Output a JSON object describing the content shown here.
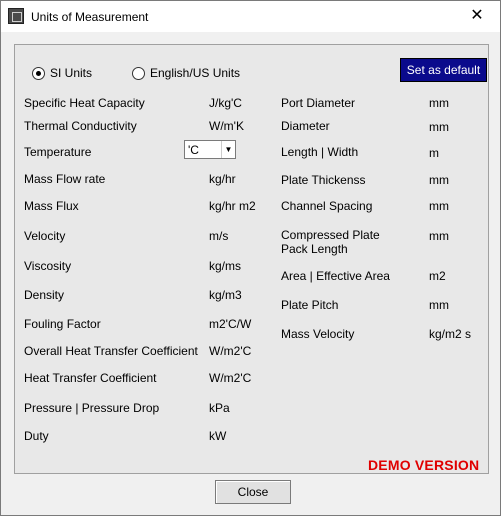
{
  "window": {
    "title": "Units of Measurement",
    "close_glyph": "✕"
  },
  "unit_system": {
    "si_label": "SI Units",
    "english_label": "English/US Units",
    "selected": "SI Units"
  },
  "set_default_label": "Set as default",
  "left_rows": [
    {
      "label": "Specific Heat Capacity",
      "unit": "J/kg'C"
    },
    {
      "label": "Thermal Conductivity",
      "unit": "W/m'K"
    },
    {
      "label": "Temperature",
      "unit": "'C"
    },
    {
      "label": "Mass Flow rate",
      "unit": "kg/hr"
    },
    {
      "label": "Mass Flux",
      "unit": "kg/hr m2"
    },
    {
      "label": "Velocity",
      "unit": "m/s"
    },
    {
      "label": "Viscosity",
      "unit": "kg/ms"
    },
    {
      "label": "Density",
      "unit": "kg/m3"
    },
    {
      "label": "Fouling Factor",
      "unit": "m2'C/W"
    },
    {
      "label": "Overall Heat Transfer Coefficient",
      "unit": "W/m2'C"
    },
    {
      "label": "Heat Transfer Coefficient",
      "unit": "W/m2'C"
    },
    {
      "label": "Pressure | Pressure Drop",
      "unit": "kPa"
    },
    {
      "label": "Duty",
      "unit": "kW"
    }
  ],
  "right_rows": [
    {
      "label": "Port Diameter",
      "unit": "mm"
    },
    {
      "label": "Diameter",
      "unit": "mm"
    },
    {
      "label": "Length | Width",
      "unit": "m"
    },
    {
      "label": "Plate Thickenss",
      "unit": "mm"
    },
    {
      "label": "Channel Spacing",
      "unit": "mm"
    },
    {
      "label": "Compressed  Plate Pack Length",
      "unit": "mm"
    },
    {
      "label": "Area | Effective Area",
      "unit": "m2"
    },
    {
      "label": "Plate Pitch",
      "unit": "mm"
    },
    {
      "label": "Mass Velocity",
      "unit": "kg/m2 s"
    }
  ],
  "demo_label": "DEMO VERSION",
  "close_button_label": "Close"
}
